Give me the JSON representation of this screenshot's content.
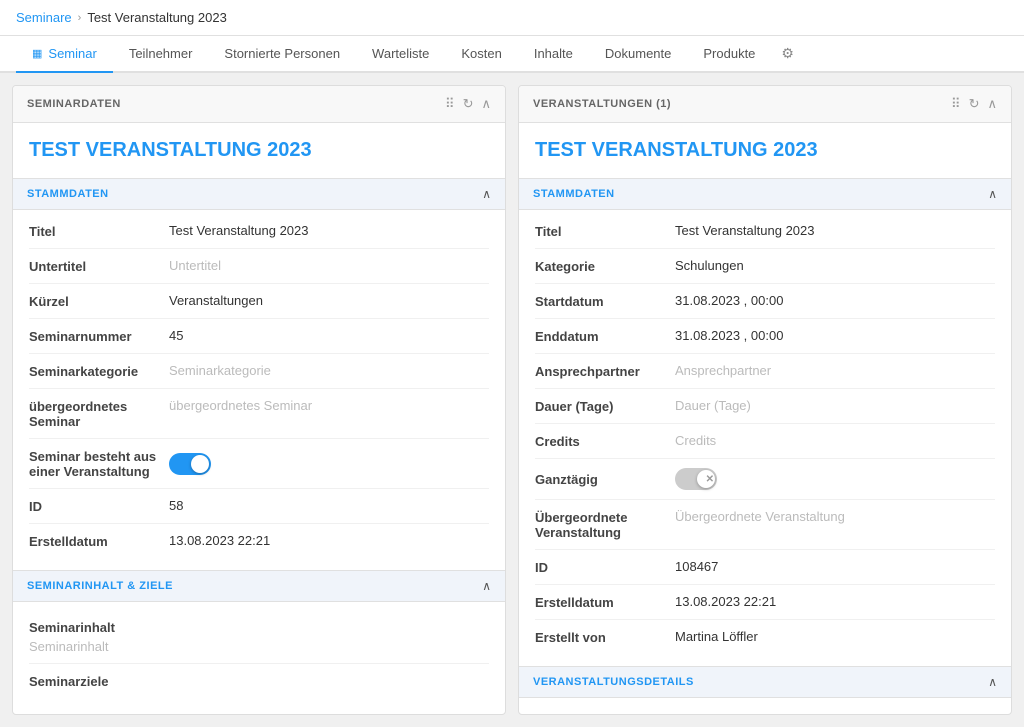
{
  "breadcrumb": {
    "parent": "Seminare",
    "current": "Test Veranstaltung 2023"
  },
  "tabs": [
    {
      "id": "seminar",
      "label": "Seminar",
      "icon": "▦",
      "active": true
    },
    {
      "id": "teilnehmer",
      "label": "Teilnehmer",
      "active": false
    },
    {
      "id": "stornierte",
      "label": "Stornierte Personen",
      "active": false
    },
    {
      "id": "warteliste",
      "label": "Warteliste",
      "active": false
    },
    {
      "id": "kosten",
      "label": "Kosten",
      "active": false
    },
    {
      "id": "inhalte",
      "label": "Inhalte",
      "active": false
    },
    {
      "id": "dokumente",
      "label": "Dokumente",
      "active": false
    },
    {
      "id": "produkte",
      "label": "Produkte",
      "active": false
    }
  ],
  "left_panel": {
    "header": "SEMINARDATEN",
    "title": "TEST VERANSTALTUNG 2023",
    "stammdaten_title": "STAMMDATEN",
    "fields": [
      {
        "label": "Titel",
        "value": "Test Veranstaltung 2023",
        "placeholder": false
      },
      {
        "label": "Untertitel",
        "value": "Untertitel",
        "placeholder": true
      },
      {
        "label": "Kürzel",
        "value": "Veranstaltungen",
        "placeholder": false
      },
      {
        "label": "Seminarnummer",
        "value": "45",
        "placeholder": false
      },
      {
        "label": "Seminarkategorie",
        "value": "Seminarkategorie",
        "placeholder": true
      }
    ],
    "field_parent": {
      "label": "übergeordnetes Seminar",
      "value": "übergeordnetes Seminar",
      "placeholder": true
    },
    "field_toggle": {
      "label": "Seminar besteht aus einer Veranstaltung",
      "enabled": true
    },
    "field_id": {
      "label": "ID",
      "value": "58"
    },
    "field_erstelldatum": {
      "label": "Erstelldatum",
      "value": "13.08.2023 22:21"
    },
    "seminarinhalt_title": "SEMINARINHALT & ZIELE",
    "field_seminarinhalt": {
      "label": "Seminarinhalt",
      "value": "Seminarinhalt",
      "placeholder": true
    },
    "field_seminarziele": {
      "label": "Seminarziele",
      "value": ""
    }
  },
  "right_panel": {
    "header": "VERANSTALTUNGEN (1)",
    "title": "TEST VERANSTALTUNG 2023",
    "stammdaten_title": "STAMMDATEN",
    "fields": [
      {
        "label": "Titel",
        "value": "Test Veranstaltung 2023",
        "placeholder": false
      },
      {
        "label": "Kategorie",
        "value": "Schulungen",
        "placeholder": false
      },
      {
        "label": "Startdatum",
        "value": "31.08.2023 ,  00:00",
        "placeholder": false
      },
      {
        "label": "Enddatum",
        "value": "31.08.2023 ,  00:00",
        "placeholder": false
      },
      {
        "label": "Ansprechpartner",
        "value": "Ansprechpartner",
        "placeholder": true
      },
      {
        "label": "Dauer (Tage)",
        "value": "Dauer (Tage)",
        "placeholder": true
      },
      {
        "label": "Credits",
        "value": "Credits",
        "placeholder": true
      }
    ],
    "field_ganztaegig": {
      "label": "Ganztägig",
      "enabled": false
    },
    "field_uebergeordnete": {
      "label": "Übergeordnete Veranstaltung",
      "value": "Übergeordnete Veranstaltung",
      "placeholder": true
    },
    "field_id": {
      "label": "ID",
      "value": "108467"
    },
    "field_erstelldatum": {
      "label": "Erstelldatum",
      "value": "13.08.2023 22:21"
    },
    "field_erstellt_von": {
      "label": "Erstellt von",
      "value": "Martina Löffler"
    },
    "veranstaltungsdetails_title": "VERANSTALTUNGSDETAILS"
  }
}
